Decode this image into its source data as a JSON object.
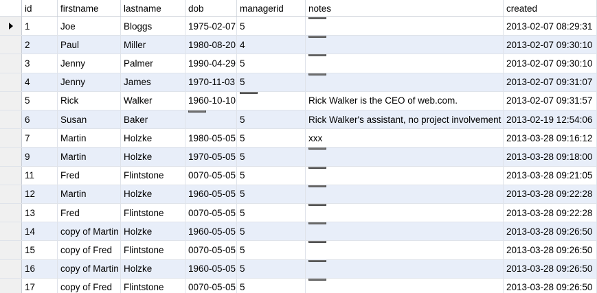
{
  "grid": {
    "columns": [
      "id",
      "firstname",
      "lastname",
      "dob",
      "managerid",
      "notes",
      "created"
    ],
    "null_label": "NULL",
    "current_row_icon": "row-pointer-icon",
    "rows": [
      {
        "id": "1",
        "firstname": "Joe",
        "lastname": "Bloggs",
        "dob": "1975-02-07",
        "managerid": "5",
        "notes": null,
        "created": "2013-02-07 08:29:31"
      },
      {
        "id": "2",
        "firstname": "Paul",
        "lastname": "Miller",
        "dob": "1980-08-20",
        "managerid": "4",
        "notes": null,
        "created": "2013-02-07 09:30:10"
      },
      {
        "id": "3",
        "firstname": "Jenny",
        "lastname": "Palmer",
        "dob": "1990-04-29",
        "managerid": "5",
        "notes": null,
        "created": "2013-02-07 09:30:10"
      },
      {
        "id": "4",
        "firstname": "Jenny",
        "lastname": "James",
        "dob": "1970-11-03",
        "managerid": "5",
        "notes": null,
        "created": "2013-02-07 09:31:07"
      },
      {
        "id": "5",
        "firstname": "Rick",
        "lastname": "Walker",
        "dob": "1960-10-10",
        "managerid": null,
        "notes": "Rick Walker is the CEO of web.com.",
        "created": "2013-02-07 09:31:57"
      },
      {
        "id": "6",
        "firstname": "Susan",
        "lastname": "Baker",
        "dob": null,
        "managerid": "5",
        "notes": "Rick Walker's assistant, no project involvement",
        "created": "2013-02-19 12:54:06"
      },
      {
        "id": "7",
        "firstname": "Martin",
        "lastname": "Holzke",
        "dob": "1980-05-05",
        "managerid": "5",
        "notes": "xxx",
        "created": "2013-03-28 09:16:12"
      },
      {
        "id": "9",
        "firstname": "Martin",
        "lastname": "Holzke",
        "dob": "1970-05-05",
        "managerid": "5",
        "notes": null,
        "created": "2013-03-28 09:18:00"
      },
      {
        "id": "11",
        "firstname": "Fred",
        "lastname": "Flintstone",
        "dob": "0070-05-05",
        "managerid": "5",
        "notes": null,
        "created": "2013-03-28 09:21:05"
      },
      {
        "id": "12",
        "firstname": "Martin",
        "lastname": "Holzke",
        "dob": "1960-05-05",
        "managerid": "5",
        "notes": null,
        "created": "2013-03-28 09:22:28"
      },
      {
        "id": "13",
        "firstname": "Fred",
        "lastname": "Flintstone",
        "dob": "0070-05-05",
        "managerid": "5",
        "notes": null,
        "created": "2013-03-28 09:22:28"
      },
      {
        "id": "14",
        "firstname": "copy of Martin",
        "lastname": "Holzke",
        "dob": "1960-05-05",
        "managerid": "5",
        "notes": null,
        "created": "2013-03-28 09:26:50"
      },
      {
        "id": "15",
        "firstname": "copy of Fred",
        "lastname": "Flintstone",
        "dob": "0070-05-05",
        "managerid": "5",
        "notes": null,
        "created": "2013-03-28 09:26:50"
      },
      {
        "id": "16",
        "firstname": "copy of Martin",
        "lastname": "Holzke",
        "dob": "1960-05-05",
        "managerid": "5",
        "notes": null,
        "created": "2013-03-28 09:26:50"
      },
      {
        "id": "17",
        "firstname": "copy of Fred",
        "lastname": "Flintstone",
        "dob": "0070-05-05",
        "managerid": "5",
        "notes": null,
        "created": "2013-03-28 09:26:50"
      }
    ]
  },
  "colors": {
    "row_even": "#e8eef9",
    "row_odd": "#ffffff",
    "null_badge": "#707070"
  }
}
